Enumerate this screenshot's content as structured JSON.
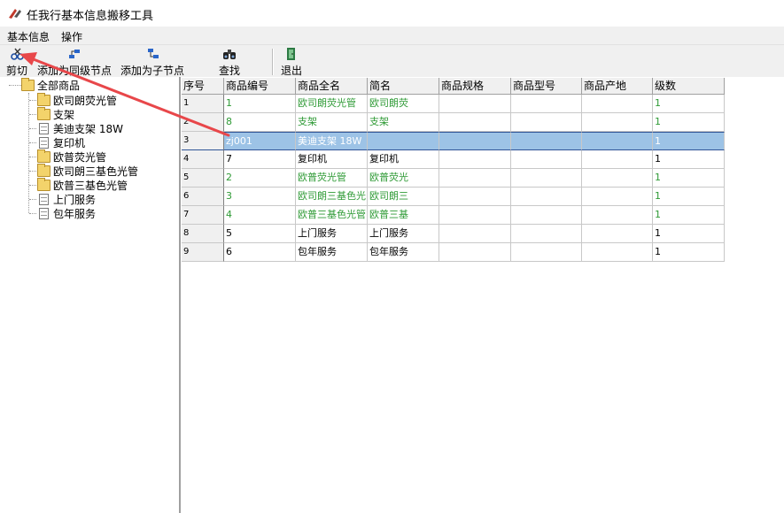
{
  "window": {
    "title": "任我行基本信息搬移工具"
  },
  "menu": {
    "items": [
      "基本信息",
      "操作"
    ]
  },
  "toolbar": {
    "cut_label": "剪切",
    "add_sibling_label": "添加为同级节点",
    "add_child_label": "添加为子节点",
    "find_label": "查找",
    "exit_label": "退出"
  },
  "tree": {
    "root": "全部商品",
    "items": [
      {
        "label": "欧司朗荧光管",
        "type": "folder"
      },
      {
        "label": "支架",
        "type": "folder"
      },
      {
        "label": "美迪支架 18W",
        "type": "file"
      },
      {
        "label": "复印机",
        "type": "file"
      },
      {
        "label": "欧普荧光管",
        "type": "folder"
      },
      {
        "label": "欧司朗三基色光管",
        "type": "folder"
      },
      {
        "label": "欧普三基色光管",
        "type": "folder"
      },
      {
        "label": "上门服务",
        "type": "file"
      },
      {
        "label": "包年服务",
        "type": "file"
      }
    ]
  },
  "grid": {
    "headers": [
      "序号",
      "商品编号",
      "商品全名",
      "简名",
      "商品规格",
      "商品型号",
      "商品产地",
      "级数"
    ],
    "rows": [
      {
        "seq": "1",
        "code": "1",
        "name": "欧司朗荧光管",
        "short": "欧司朗荧",
        "spec": "",
        "model": "",
        "origin": "",
        "level": "1",
        "color": "green"
      },
      {
        "seq": "2",
        "code": "8",
        "name": "支架",
        "short": "支架",
        "spec": "",
        "model": "",
        "origin": "",
        "level": "1",
        "color": "green"
      },
      {
        "seq": "3",
        "code": "zj001",
        "name": "美迪支架 18W",
        "short": "",
        "spec": "",
        "model": "",
        "origin": "",
        "level": "1",
        "color": "selected"
      },
      {
        "seq": "4",
        "code": "7",
        "name": "复印机",
        "short": "复印机",
        "spec": "",
        "model": "",
        "origin": "",
        "level": "1",
        "color": "black"
      },
      {
        "seq": "5",
        "code": "2",
        "name": "欧普荧光管",
        "short": "欧普荧光",
        "spec": "",
        "model": "",
        "origin": "",
        "level": "1",
        "color": "green"
      },
      {
        "seq": "6",
        "code": "3",
        "name": "欧司朗三基色光",
        "short": "欧司朗三",
        "spec": "",
        "model": "",
        "origin": "",
        "level": "1",
        "color": "green"
      },
      {
        "seq": "7",
        "code": "4",
        "name": "欧普三基色光管",
        "short": "欧普三基",
        "spec": "",
        "model": "",
        "origin": "",
        "level": "1",
        "color": "green"
      },
      {
        "seq": "8",
        "code": "5",
        "name": "上门服务",
        "short": "上门服务",
        "spec": "",
        "model": "",
        "origin": "",
        "level": "1",
        "color": "black"
      },
      {
        "seq": "9",
        "code": "6",
        "name": "包年服务",
        "short": "包年服务",
        "spec": "",
        "model": "",
        "origin": "",
        "level": "1",
        "color": "black"
      }
    ]
  },
  "colors": {
    "green_text": "#2e9a35",
    "selection": "#9dc3e6",
    "arrow": "#e8474a"
  },
  "icons": [
    "app-icon",
    "cut-icon",
    "add-sibling-icon",
    "add-child-icon",
    "binoculars-icon",
    "exit-icon",
    "folder-icon",
    "file-icon"
  ]
}
